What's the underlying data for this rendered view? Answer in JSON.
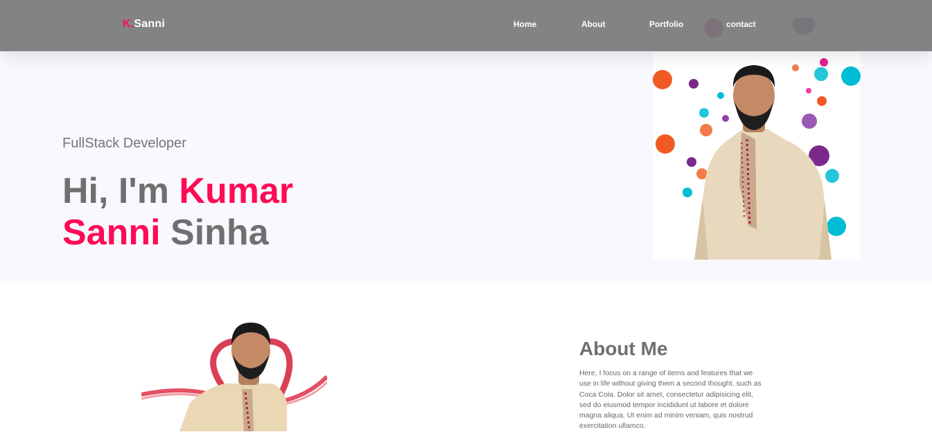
{
  "nav": {
    "brand_prefix": "K.",
    "brand_name": "Sanni",
    "links": [
      "Home",
      "About",
      "Portfolio",
      "contact"
    ]
  },
  "hero": {
    "subtitle": "FullStack Developer",
    "greeting": "Hi, I'm",
    "name_part1": "Kumar",
    "name_part2": "Sanni",
    "name_part3": "Sinha"
  },
  "about": {
    "heading": "About Me",
    "paragraph": "Here, I focus on a range of items and features that we use in life without giving them a second thought. such as Coca Cola. Dolor sit amet, consectetur adipisicing elit, sed do eiusmod tempor incididunt ut labore et dolore magna aliqua. Ut enim ad minim veniam, quis nostrud exercitation ullamco."
  },
  "colors": {
    "accent": "#ff0a54",
    "navbar": "#7a7a7a",
    "text_gray": "#6f6f6f",
    "hero_bg": "#f8f8fe"
  }
}
